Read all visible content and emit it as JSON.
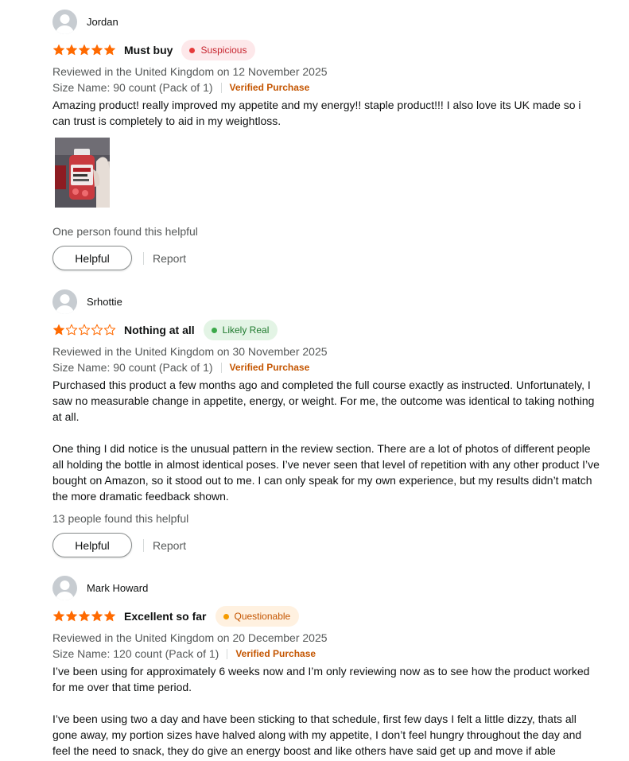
{
  "colors": {
    "star": "#ff6a00",
    "suspicious_bg": "#fde8ea",
    "suspicious_text": "#c7252f",
    "suspicious_dot": "#e53b3b",
    "likely_real_bg": "#e3f4e5",
    "likely_real_text": "#1f7a2e",
    "likely_real_dot": "#3ca94a",
    "questionable_bg": "#fff1e0",
    "questionable_text": "#c45500",
    "questionable_dot": "#f59b00",
    "verified": "#c45500"
  },
  "reviews": [
    {
      "author": "Jordan",
      "rating": 5,
      "title": "Must buy",
      "badge": "Suspicious",
      "badge_kind": "suspicious",
      "reviewed": "Reviewed in the United Kingdom on 12 November 2025",
      "variant": "Size Name: 90 count (Pack of 1)",
      "verified": "Verified Purchase",
      "body": [
        "Amazing product! really improved my appetite and my energy!! staple product!!! I also love its UK made so i can trust is completely to aid in my weightloss."
      ],
      "helpful_count": "One person found this helpful",
      "helpful_label": "Helpful",
      "report_label": "Report"
    },
    {
      "author": "Srhottie",
      "rating": 1,
      "title": "Nothing at all",
      "badge": "Likely Real",
      "badge_kind": "likely_real",
      "reviewed": "Reviewed in the United Kingdom on 30 November 2025",
      "variant": "Size Name: 90 count (Pack of 1)",
      "verified": "Verified Purchase",
      "body": [
        "Purchased this product a few months ago and completed the full course exactly as instructed. Unfortunately, I saw no measurable change in appetite, energy, or weight. For me, the outcome was identical to taking nothing at all.",
        "One thing I did notice is the unusual pattern in the review section. There are a lot of photos of different people all holding the bottle in almost identical poses. I’ve never seen that level of repetition with any other product I’ve bought on Amazon, so it stood out to me. I can only speak for my own experience, but my results didn’t match the more dramatic feedback shown."
      ],
      "helpful_count": "13 people found this helpful",
      "helpful_label": "Helpful",
      "report_label": "Report"
    },
    {
      "author": "Mark Howard",
      "rating": 5,
      "title": "Excellent so far",
      "badge": "Questionable",
      "badge_kind": "questionable",
      "reviewed": "Reviewed in the United Kingdom on 20 December 2025",
      "variant": "Size Name: 120 count (Pack of 1)",
      "verified": "Verified Purchase",
      "body": [
        "I’ve been using for approximately 6 weeks now and I’m only reviewing now as to see how the product worked for me over that time period.",
        "I’ve been using two a day and have been sticking to that schedule, first few days I felt a little dizzy, thats all gone away, my portion sizes have halved along with my appetite, I don’t feel hungry throughout the day and feel the need to snack, they do give an energy boost and like others have said get up and move if able"
      ]
    }
  ]
}
